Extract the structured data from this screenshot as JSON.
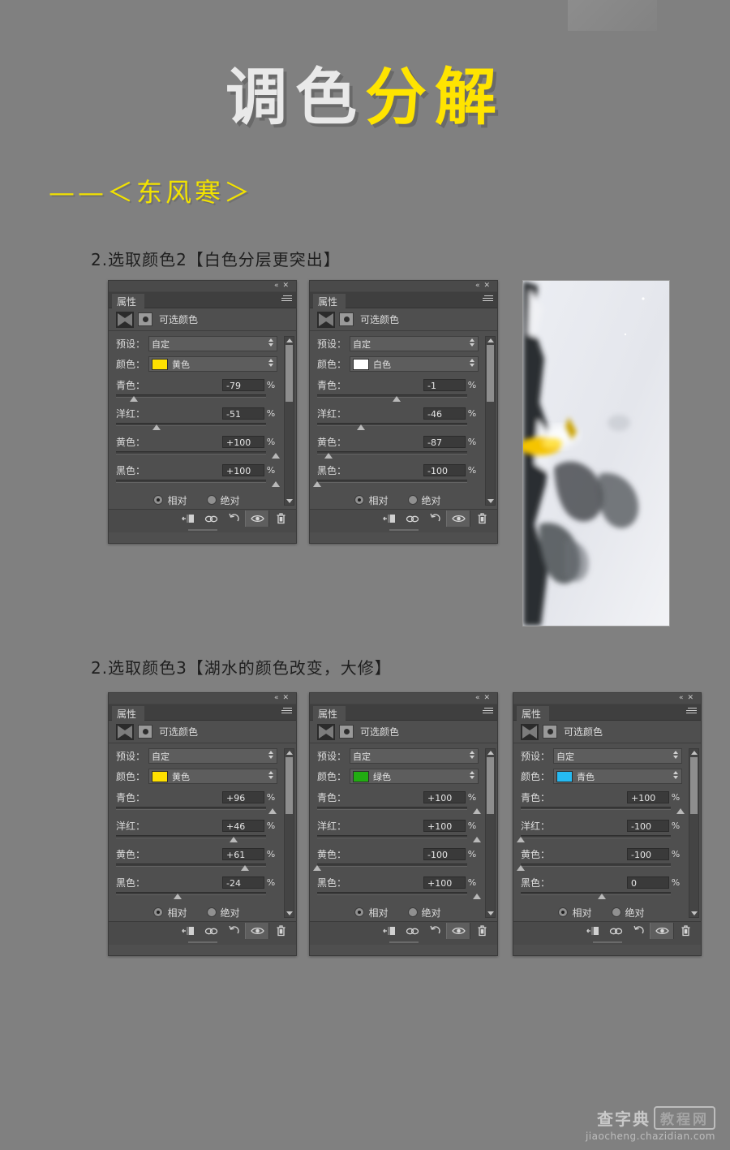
{
  "title": {
    "white_part": "调色",
    "yellow_part": "分解"
  },
  "subtitle": "——＜东风寒＞",
  "sections": [
    {
      "heading": "2.选取颜色2【白色分层更突出】"
    },
    {
      "heading": "2.选取颜色3【湖水的颜色改变，大修】"
    }
  ],
  "panel_common": {
    "tab_label": "属性",
    "adjustment_name": "可选颜色",
    "preset_label": "预设：",
    "preset_value": "自定",
    "color_label": "颜色：",
    "slider_labels": [
      "青色：",
      "洋红：",
      "黄色：",
      "黑色："
    ],
    "percent_sign": "%",
    "radio_relative": "相对",
    "radio_absolute": "绝对",
    "collapse_icon": "collapse-icon",
    "close_icon": "close-icon",
    "menu_icon": "panel-menu-icon",
    "footer_icons": [
      "clip-to-layer-icon",
      "link-layers-icon",
      "reset-icon",
      "toggle-visibility-icon",
      "delete-icon"
    ]
  },
  "panels": [
    {
      "id": "panel-1",
      "color_name": "黄色",
      "color_hex": "#ffe100",
      "values": [
        "-79",
        "-51",
        "+100",
        "+100"
      ],
      "thumb_pos": [
        11,
        25,
        99,
        99
      ],
      "selected_mode": "相对"
    },
    {
      "id": "panel-2",
      "color_name": "白色",
      "color_hex": "#ffffff",
      "values": [
        "-1",
        "-46",
        "-87",
        "-100"
      ],
      "thumb_pos": [
        49,
        27,
        7,
        0
      ],
      "selected_mode": "相对"
    },
    {
      "id": "panel-3",
      "color_name": "黄色",
      "color_hex": "#ffe100",
      "values": [
        "+96",
        "+46",
        "+61",
        "-24"
      ],
      "thumb_pos": [
        97,
        73,
        80,
        38
      ],
      "selected_mode": "相对"
    },
    {
      "id": "panel-4",
      "color_name": "绿色",
      "color_hex": "#21ad11",
      "values": [
        "+100",
        "+100",
        "-100",
        "+100"
      ],
      "thumb_pos": [
        99,
        99,
        0,
        99
      ],
      "selected_mode": "相对"
    },
    {
      "id": "panel-5",
      "color_name": "青色",
      "color_hex": "#25baf2",
      "values": [
        "+100",
        "-100",
        "-100",
        "0"
      ],
      "thumb_pos": [
        99,
        0,
        0,
        50
      ],
      "selected_mode": "相对"
    }
  ],
  "photo": {
    "alt_name": "edited-photo-preview"
  },
  "watermark": {
    "brand": "查字典",
    "badge": "教程网",
    "url": "jiaocheng.chazidian.com"
  }
}
